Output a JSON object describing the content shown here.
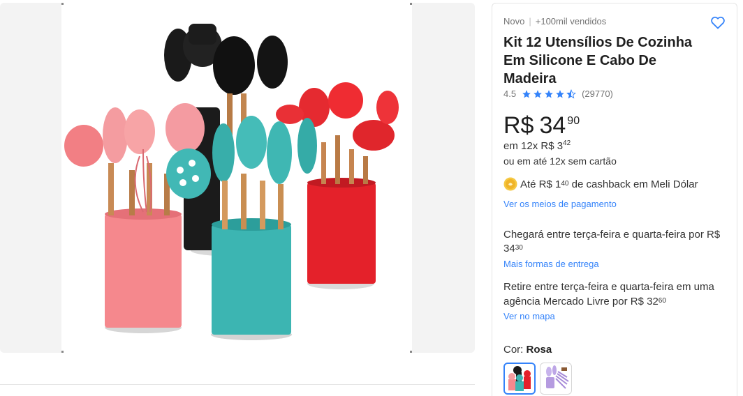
{
  "gallery": {
    "image_alt": "Kit utensílios de silicone em potes rosa, azul, preto e vermelho"
  },
  "product": {
    "condition": "Novo",
    "sold": "+100mil vendidos",
    "title": "Kit 12 Utensílios De Cozinha Em Silicone E Cabo De Madeira",
    "rating": "4.5",
    "rating_value": 4.5,
    "reviews": "(29770)",
    "currency": "R$",
    "price_int": "34",
    "price_cents": "90",
    "installments_prefix": "em 12x R$ 3",
    "installments_cents": "42",
    "installments_no_card": "ou em até 12x sem cartão",
    "cashback_prefix": "Até R$ 1",
    "cashback_cents": "40",
    "cashback_suffix": " de cashback em Meli Dólar",
    "payment_link": "Ver os meios de pagamento",
    "shipping_text": "Chegará entre terça-feira e quarta-feira por R$ 34",
    "shipping_cents": "30",
    "shipping_link": "Mais formas de entrega",
    "pickup_text": "Retire entre terça-feira e quarta-feira em uma agência Mercado Livre por R$ 32",
    "pickup_cents": "60",
    "map_link": "Ver no mapa",
    "color_label": "Cor: ",
    "color_value": "Rosa"
  },
  "colors": {
    "accent": "#3483fa",
    "star": "#3483fa",
    "teal": "#3bb3b0",
    "pink": "#f4848a",
    "red": "#e8232b",
    "black": "#1a1a1a",
    "coin": "#f5c842"
  },
  "icons": {
    "favorite": "heart-outline-icon",
    "star": "star-icon",
    "coin": "meli-dolar-coin-icon"
  }
}
